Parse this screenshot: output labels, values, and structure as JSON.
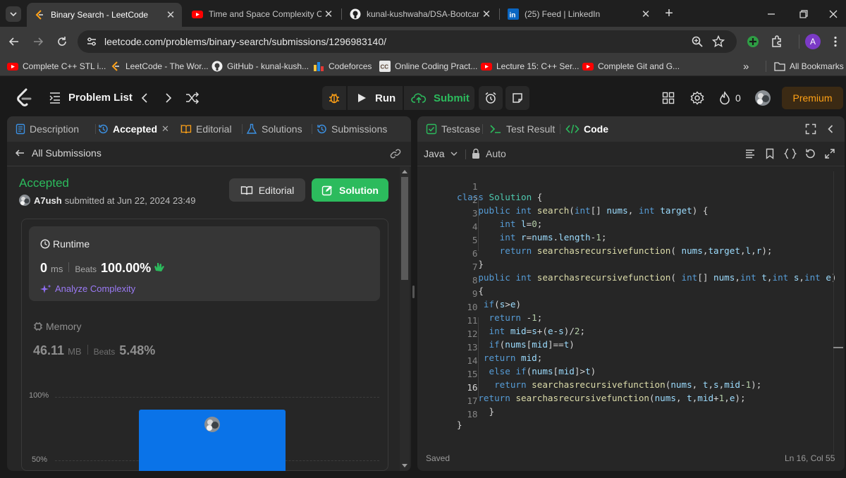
{
  "browser": {
    "tabs": [
      {
        "title": "Binary Search - LeetCode",
        "icon": "leetcode-icon",
        "active": true
      },
      {
        "title": "Time and Space Complexity CO",
        "icon": "youtube-icon",
        "active": false
      },
      {
        "title": "kunal-kushwaha/DSA-Bootcamp",
        "icon": "github-icon",
        "active": false
      },
      {
        "title": "(25) Feed | LinkedIn",
        "icon": "linkedin-icon",
        "active": false
      }
    ],
    "url": "leetcode.com/problems/binary-search/submissions/1296983140/",
    "profile_initial": "A",
    "bookmarks": [
      {
        "label": "Complete C++ STL i...",
        "icon": "youtube-icon"
      },
      {
        "label": "LeetCode - The Wor...",
        "icon": "leetcode-icon"
      },
      {
        "label": "GitHub - kunal-kush...",
        "icon": "github-icon"
      },
      {
        "label": "Codeforces",
        "icon": "codeforces-icon"
      },
      {
        "label": "Online Coding Pract...",
        "icon": "codechef-icon"
      },
      {
        "label": "Lecture 15: C++ Ser...",
        "icon": "youtube-icon"
      },
      {
        "label": "Complete Git and G...",
        "icon": "youtube-icon"
      }
    ],
    "all_bookmarks": "All Bookmarks"
  },
  "header": {
    "problem_list": "Problem List",
    "run": "Run",
    "submit": "Submit",
    "streak_count": "0",
    "premium": "Premium"
  },
  "left": {
    "tabs": {
      "description": "Description",
      "accepted": "Accepted",
      "editorial": "Editorial",
      "solutions": "Solutions",
      "submissions": "Submissions"
    },
    "all_submissions": "All Submissions",
    "status": "Accepted",
    "user": "A7ush",
    "submitted_at": "submitted at Jun 22, 2024 23:49",
    "editorial_btn": "Editorial",
    "solution_btn": "Solution",
    "runtime": {
      "label": "Runtime",
      "value": "0",
      "unit": "ms",
      "beats_label": "Beats",
      "beats": "100.00%",
      "analyze": "Analyze Complexity"
    },
    "memory": {
      "label": "Memory",
      "value": "46.11",
      "unit": "MB",
      "beats_label": "Beats",
      "beats": "5.48%"
    },
    "chart_axis": {
      "top": "100%",
      "mid": "50%"
    }
  },
  "right": {
    "tabs": {
      "testcase": "Testcase",
      "result": "Test Result",
      "code": "Code"
    },
    "language": "Java",
    "auto": "Auto",
    "status": "Saved",
    "cursor": "Ln 16, Col 55",
    "code_lines": [
      "class Solution {",
      "    public int search(int[] nums, int target) {",
      "        int l=0;",
      "        int r=nums.length-1;",
      "        return searchasrecursivefunction( nums,target,l,r);",
      "    }",
      "    public int searchasrecursivefunction( int[] nums,int t,int s,int e)",
      "    {",
      "     if(s>e)",
      "      return -1;",
      "      int mid=s+(e-s)/2;",
      "      if(nums[mid]==t)",
      "     return mid;",
      "      else if(nums[mid]>t)",
      "       return searchasrecursivefunction(nums, t,s,mid-1);",
      "    return searchasrecursivefunction(nums, t,mid+1,e);",
      "      }",
      "}"
    ]
  },
  "colors": {
    "accepted_green": "#2cbb5d",
    "bar_blue": "#0a73e8",
    "premium_orange": "#ffa116",
    "keyword_blue": "#569cd6",
    "function_yellow": "#dcdcaa"
  }
}
